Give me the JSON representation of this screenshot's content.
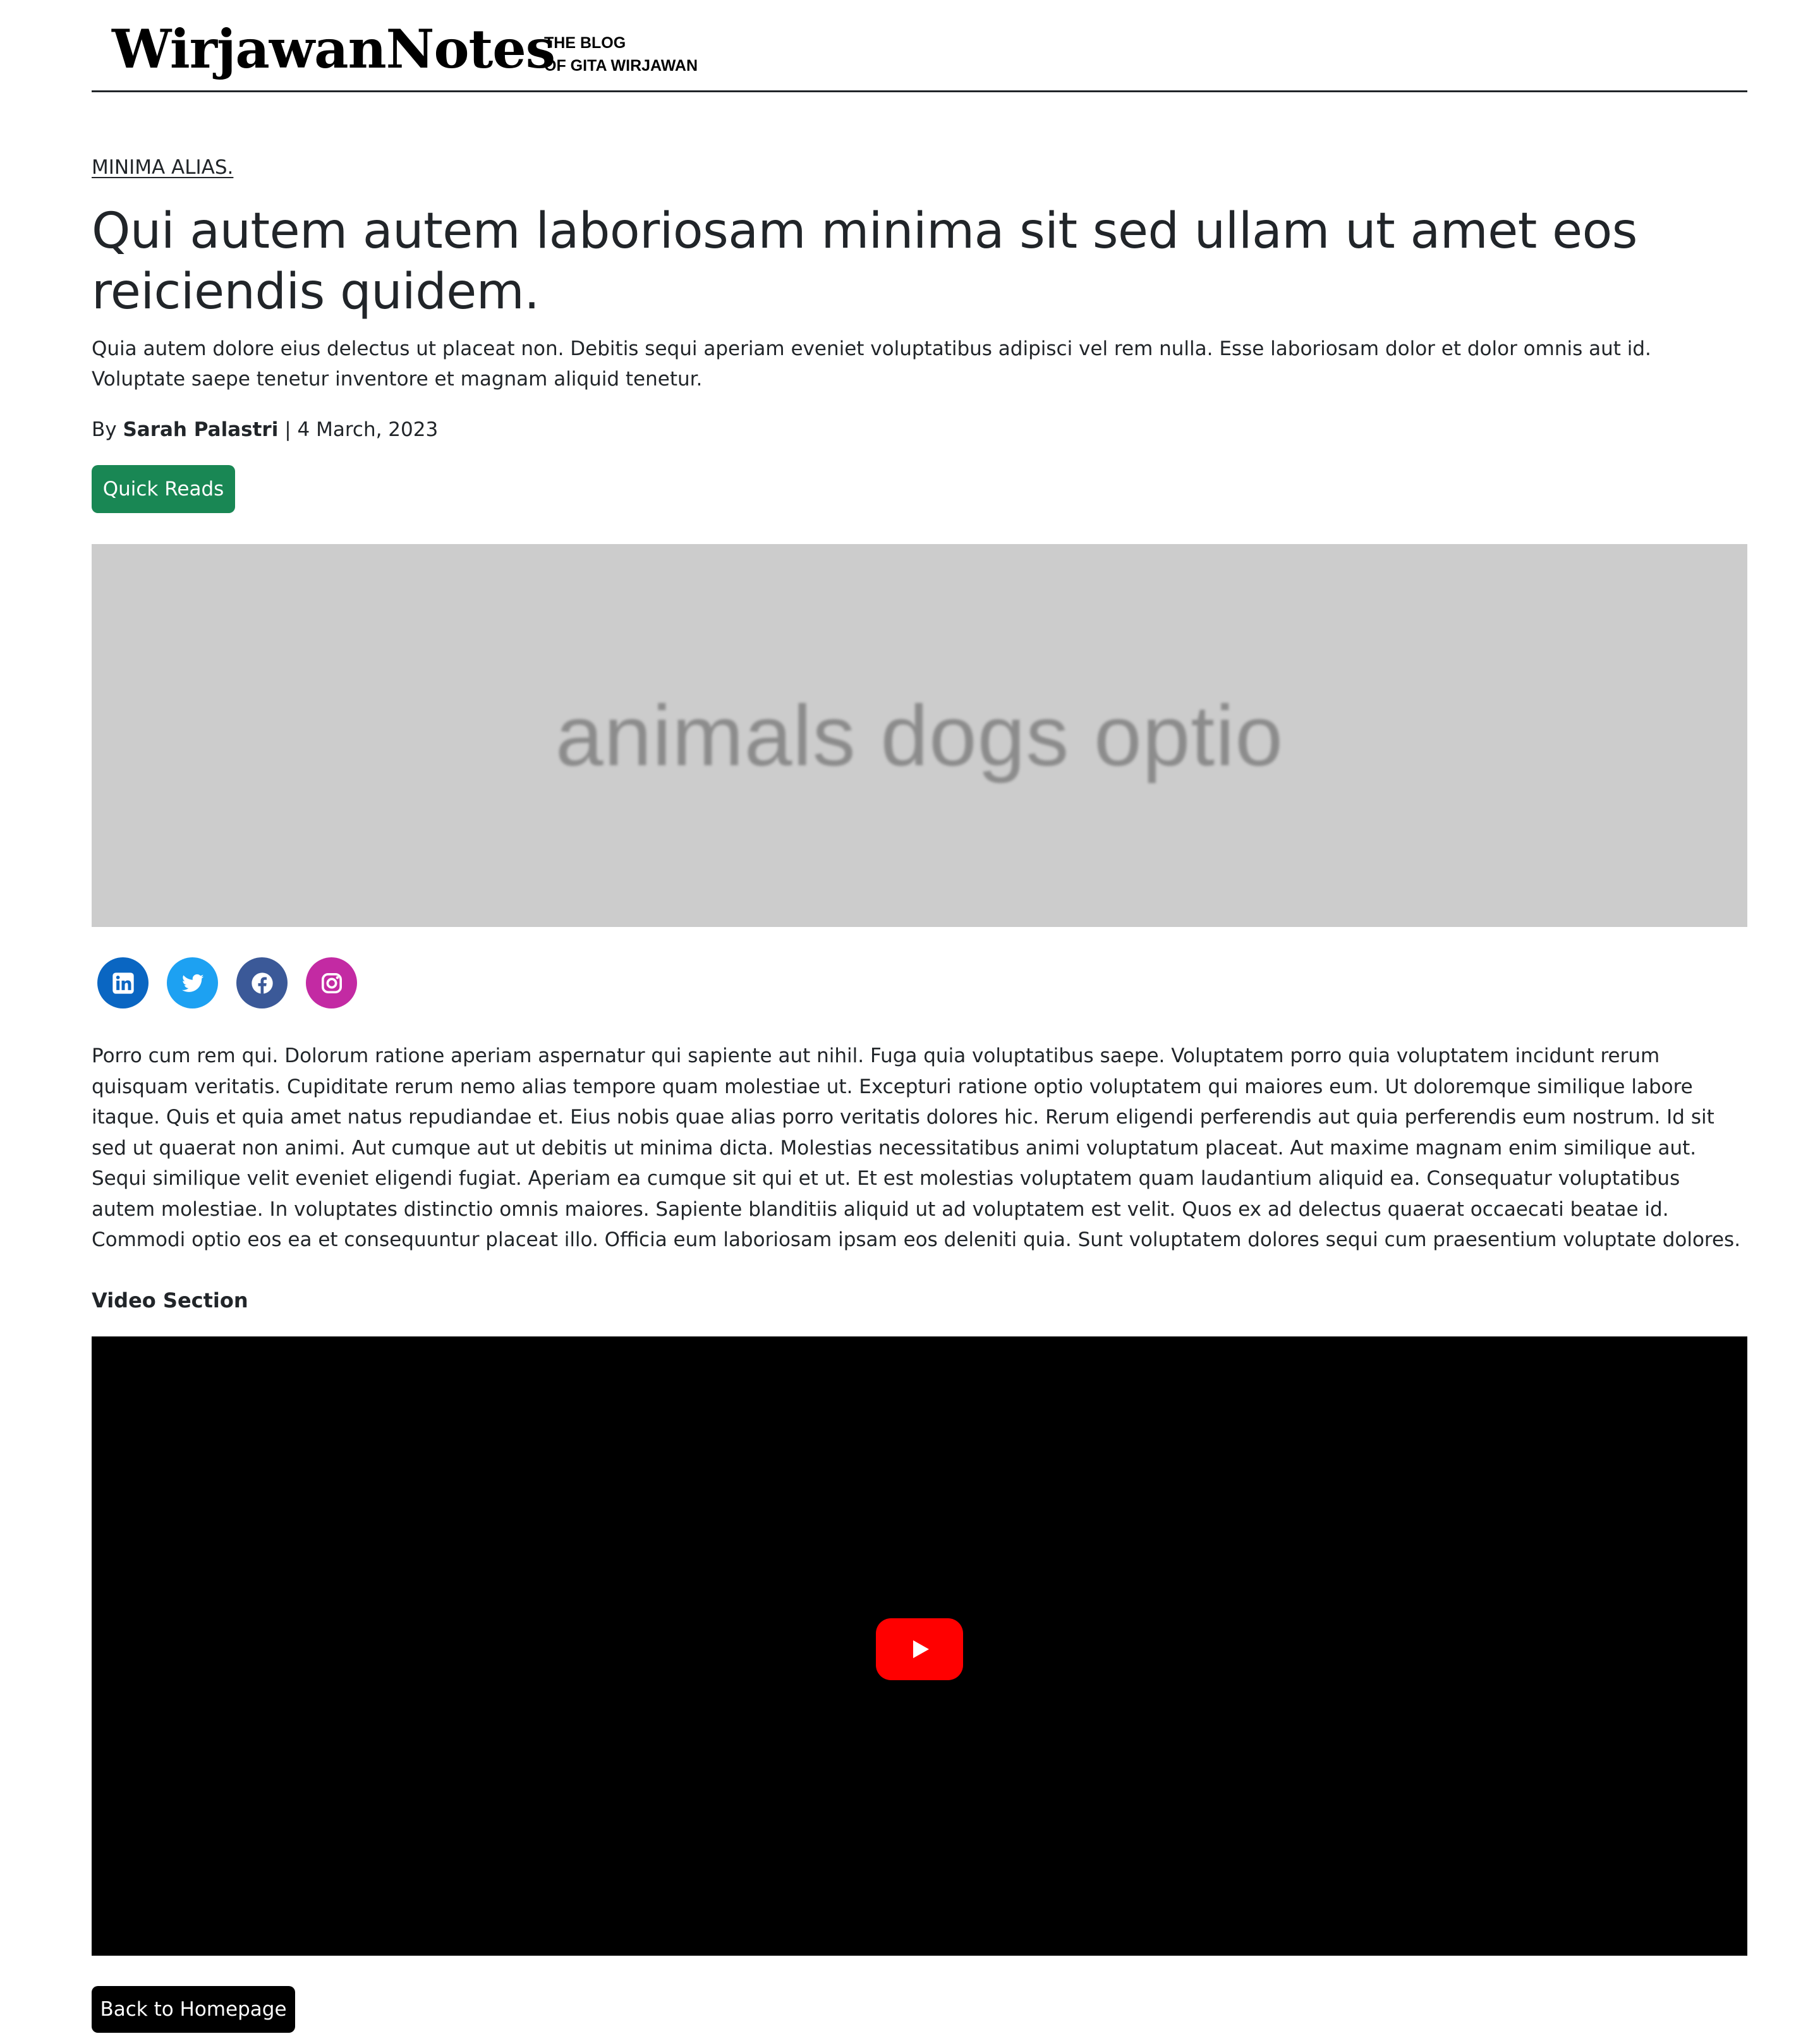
{
  "header": {
    "logo": "WirjawanNotes",
    "tagline_line1": "THE BLOG",
    "tagline_line2": "OF GITA WIRJAWAN"
  },
  "article": {
    "category": "MINIMA ALIAS.",
    "title": "Qui autem autem laboriosam minima sit sed ullam ut amet eos reiciendis quidem.",
    "lead": "Quia autem dolore eius delectus ut placeat non. Debitis sequi aperiam eveniet voluptatibus adipisci vel rem nulla. Esse laboriosam dolor et dolor omnis aut id. Voluptate saepe tenetur inventore et magnam aliquid tenetur.",
    "byline_prefix": "By",
    "author": "Sarah Palastri",
    "separator": "|",
    "date": "4 March, 2023",
    "tag_button": "Quick Reads",
    "hero_image_text": "animals dogs optio",
    "body": "Porro cum rem qui. Dolorum ratione aperiam aspernatur qui sapiente aut nihil. Fuga quia voluptatibus saepe. Voluptatem porro quia voluptatem incidunt rerum quisquam veritatis. Cupiditate rerum nemo alias tempore quam molestiae ut. Excepturi ratione optio voluptatem qui maiores eum. Ut doloremque similique labore itaque. Quis et quia amet natus repudiandae et. Eius nobis quae alias porro veritatis dolores hic. Rerum eligendi perferendis aut quia perferendis eum nostrum. Id sit sed ut quaerat non animi. Aut cumque aut ut debitis ut minima dicta. Molestias necessitatibus animi voluptatum placeat. Aut maxime magnam enim similique aut. Sequi similique velit eveniet eligendi fugiat. Aperiam ea cumque sit qui et ut. Et est molestias voluptatem quam laudantium aliquid ea. Consequatur voluptatibus autem molestiae. In voluptates distinctio omnis maiores. Sapiente blanditiis aliquid ut ad voluptatem est velit. Quos ex ad delectus quaerat occaecati beatae id. Commodi optio eos ea et consequuntur placeat illo. Officia eum laboriosam ipsam eos deleniti quia. Sunt voluptatem dolores sequi cum praesentium voluptate dolores.",
    "video_heading": "Video Section",
    "back_button": "Back to Homepage"
  },
  "social": [
    {
      "icon": "linkedin-icon",
      "color": "#0a66c2"
    },
    {
      "icon": "twitter-icon",
      "color": "#1da1f2"
    },
    {
      "icon": "facebook-icon",
      "color": "#3b5998"
    },
    {
      "icon": "instagram-icon",
      "color": "#c32aa3"
    }
  ],
  "colors": {
    "tag_button": "#198754",
    "hero_bg": "#cccccc",
    "video_bg": "#000000",
    "youtube_red": "#ff0000"
  }
}
